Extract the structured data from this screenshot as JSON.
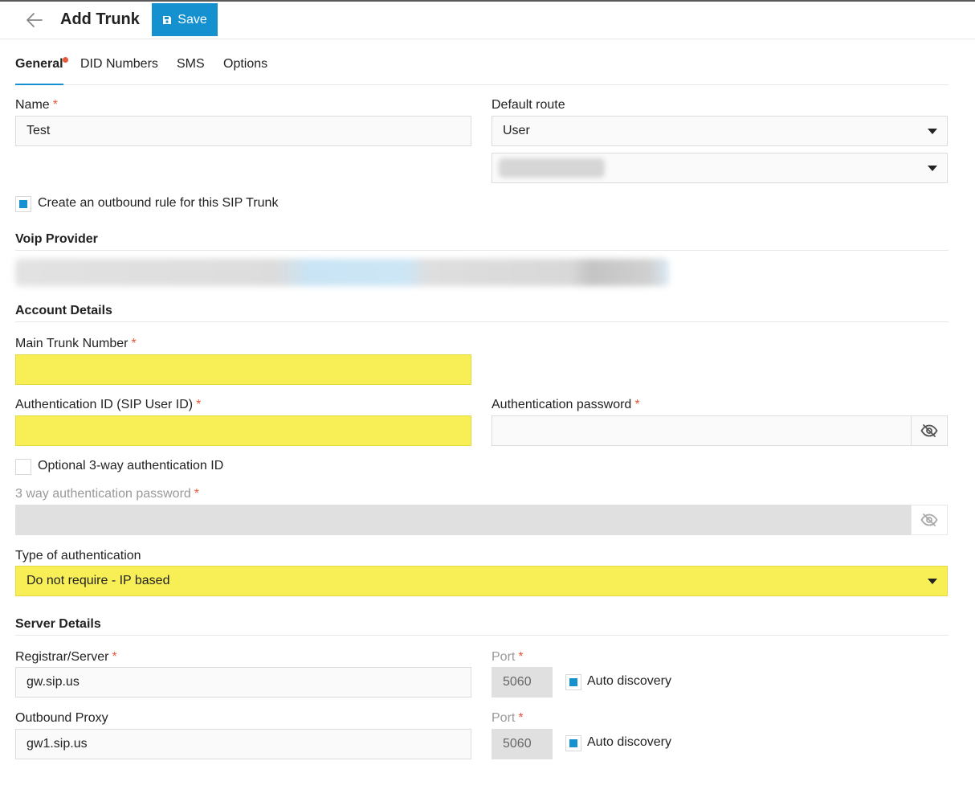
{
  "header": {
    "title": "Add Trunk",
    "save_label": "Save"
  },
  "tabs": [
    {
      "label": "General",
      "active": true,
      "has_alert_dot": true
    },
    {
      "label": "DID Numbers",
      "active": false
    },
    {
      "label": "SMS",
      "active": false
    },
    {
      "label": "Options",
      "active": false
    }
  ],
  "general": {
    "name_label": "Name",
    "name_value": "Test",
    "default_route_label": "Default route",
    "default_route_value": "User",
    "default_route_target_blurred": true,
    "outbound_rule_label": "Create an outbound rule for this SIP Trunk",
    "outbound_rule_checked": true
  },
  "voip_provider": {
    "heading": "Voip Provider",
    "info_blurred": true
  },
  "account": {
    "heading": "Account Details",
    "main_trunk_label": "Main Trunk Number",
    "main_trunk_value": "",
    "auth_id_label": "Authentication ID (SIP User ID)",
    "auth_id_value": "",
    "auth_password_label": "Authentication password",
    "auth_password_value": "",
    "optional_3way_label": "Optional 3-way authentication ID",
    "optional_3way_checked": false,
    "three_way_password_label": "3 way authentication password",
    "auth_type_label": "Type of authentication",
    "auth_type_value": "Do not require - IP based"
  },
  "server": {
    "heading": "Server Details",
    "registrar_label": "Registrar/Server",
    "registrar_value": "gw.sip.us",
    "registrar_port_label": "Port",
    "registrar_port_value": "5060",
    "registrar_auto_label": "Auto discovery",
    "registrar_auto_checked": true,
    "proxy_label": "Outbound Proxy",
    "proxy_value": "gw1.sip.us",
    "proxy_port_label": "Port",
    "proxy_port_value": "5060",
    "proxy_auto_label": "Auto discovery",
    "proxy_auto_checked": true
  },
  "required_marker": "*",
  "colors": {
    "accent": "#1591d0",
    "required": "#e8583a",
    "highlight": "#f8ef57",
    "disabled_field": "#e0e0e0"
  },
  "icons": {
    "back": "arrow-left-icon",
    "save": "floppy-disk-icon",
    "password_toggle": "eye-slash-icon",
    "dropdown": "caret-down-icon"
  }
}
